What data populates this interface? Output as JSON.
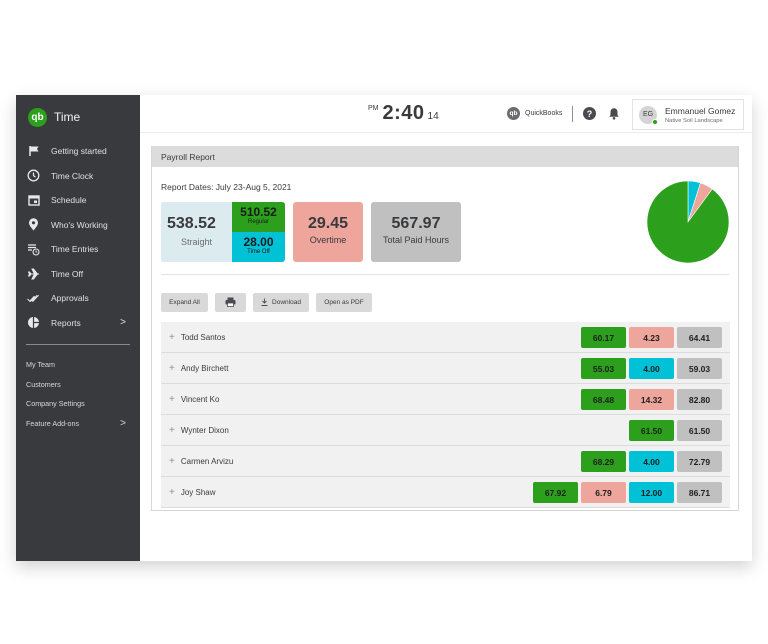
{
  "sidebar": {
    "app_name": "Time",
    "logo_text": "qb",
    "items": [
      {
        "label": "Getting started",
        "icon": "flag-icon"
      },
      {
        "label": "Time Clock",
        "icon": "clock-icon"
      },
      {
        "label": "Schedule",
        "icon": "calendar-icon"
      },
      {
        "label": "Who's Working",
        "icon": "location-pin-icon"
      },
      {
        "label": "Time Entries",
        "icon": "time-entries-icon"
      },
      {
        "label": "Time Off",
        "icon": "airplane-icon"
      },
      {
        "label": "Approvals",
        "icon": "double-check-icon"
      },
      {
        "label": "Reports",
        "icon": "pie-chart-icon",
        "chevron": ">"
      }
    ],
    "secondary": [
      {
        "label": "My Team"
      },
      {
        "label": "Customers"
      },
      {
        "label": "Company Settings"
      },
      {
        "label": "Feature Add-ons",
        "chevron": ">"
      }
    ]
  },
  "topbar": {
    "ampm": "PM",
    "time": "2:40",
    "seconds": "14",
    "quickbooks_label": "QuickBooks",
    "quickbooks_logo": "qb",
    "help_glyph": "?",
    "user": {
      "initials": "EG",
      "name": "Emmanuel Gomez",
      "company": "Native Soil Landscape",
      "status_color": "#2ca01c"
    }
  },
  "report": {
    "title": "Payroll Report",
    "dates": "Report Dates: July 23-Aug 5, 2021",
    "summary": {
      "straight": {
        "value": "538.52",
        "label": "Straight"
      },
      "regular": {
        "value": "510.52",
        "label": "Regular"
      },
      "time_off": {
        "value": "28.00",
        "label": "Time Off"
      },
      "overtime": {
        "value": "29.45",
        "label": "Overtime"
      },
      "total": {
        "value": "567.97",
        "label": "Total Paid Hours"
      }
    },
    "pie": {
      "slices": [
        {
          "name": "Time Off",
          "value": 28.0,
          "color": "#00c1d5"
        },
        {
          "name": "Overtime",
          "value": 29.45,
          "color": "#eda59c"
        },
        {
          "name": "Regular",
          "value": 510.52,
          "color": "#2ca01c"
        }
      ]
    },
    "buttons": {
      "expand_all": "Expand All",
      "download": "Download",
      "open_pdf": "Open as PDF"
    },
    "rows": [
      {
        "name": "Todd Santos",
        "cells": [
          {
            "type": "reg",
            "value": "60.17"
          },
          {
            "type": "ot",
            "value": "4.23"
          },
          {
            "type": "tot",
            "value": "64.41"
          }
        ]
      },
      {
        "name": "Andy Birchett",
        "cells": [
          {
            "type": "reg",
            "value": "55.03"
          },
          {
            "type": "off",
            "value": "4.00"
          },
          {
            "type": "tot",
            "value": "59.03"
          }
        ]
      },
      {
        "name": "Vincent Ko",
        "cells": [
          {
            "type": "reg",
            "value": "68.48"
          },
          {
            "type": "ot",
            "value": "14.32"
          },
          {
            "type": "tot",
            "value": "82.80"
          }
        ]
      },
      {
        "name": "Wynter Dixon",
        "cells": [
          {
            "type": "reg",
            "value": "61.50"
          },
          {
            "type": "tot",
            "value": "61.50"
          }
        ]
      },
      {
        "name": "Carmen Arvizu",
        "cells": [
          {
            "type": "reg",
            "value": "68.29"
          },
          {
            "type": "off",
            "value": "4.00"
          },
          {
            "type": "tot",
            "value": "72.79"
          }
        ]
      },
      {
        "name": "Joy Shaw",
        "cells": [
          {
            "type": "reg",
            "value": "67.92"
          },
          {
            "type": "ot",
            "value": "6.79"
          },
          {
            "type": "off",
            "value": "12.00"
          },
          {
            "type": "tot",
            "value": "86.71"
          }
        ]
      }
    ],
    "row_expand_glyph": "+"
  }
}
